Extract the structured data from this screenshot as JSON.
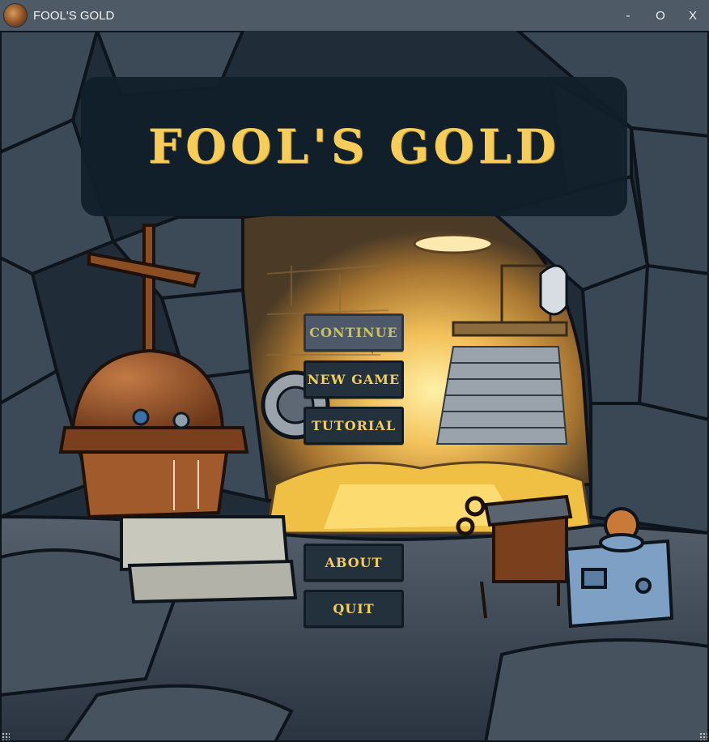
{
  "window": {
    "title": "FOOL'S GOLD",
    "controls": {
      "minimize": "-",
      "maximize": "O",
      "close": "X"
    }
  },
  "game": {
    "title": "FOOL'S GOLD",
    "menu": {
      "continue": {
        "label": "CONTINUE",
        "enabled": false
      },
      "new_game": {
        "label": "NEW GAME",
        "enabled": true
      },
      "tutorial": {
        "label": "TUTORIAL",
        "enabled": true
      },
      "about": {
        "label": "ABOUT",
        "enabled": true
      },
      "quit": {
        "label": "QUIT",
        "enabled": true
      }
    }
  },
  "colors": {
    "title_gold": "#f7cd5a",
    "button_bg": "#23313d",
    "button_disabled_bg": "#4d5968",
    "titlebar": "#4f5a67",
    "panel": "#111f2b"
  }
}
